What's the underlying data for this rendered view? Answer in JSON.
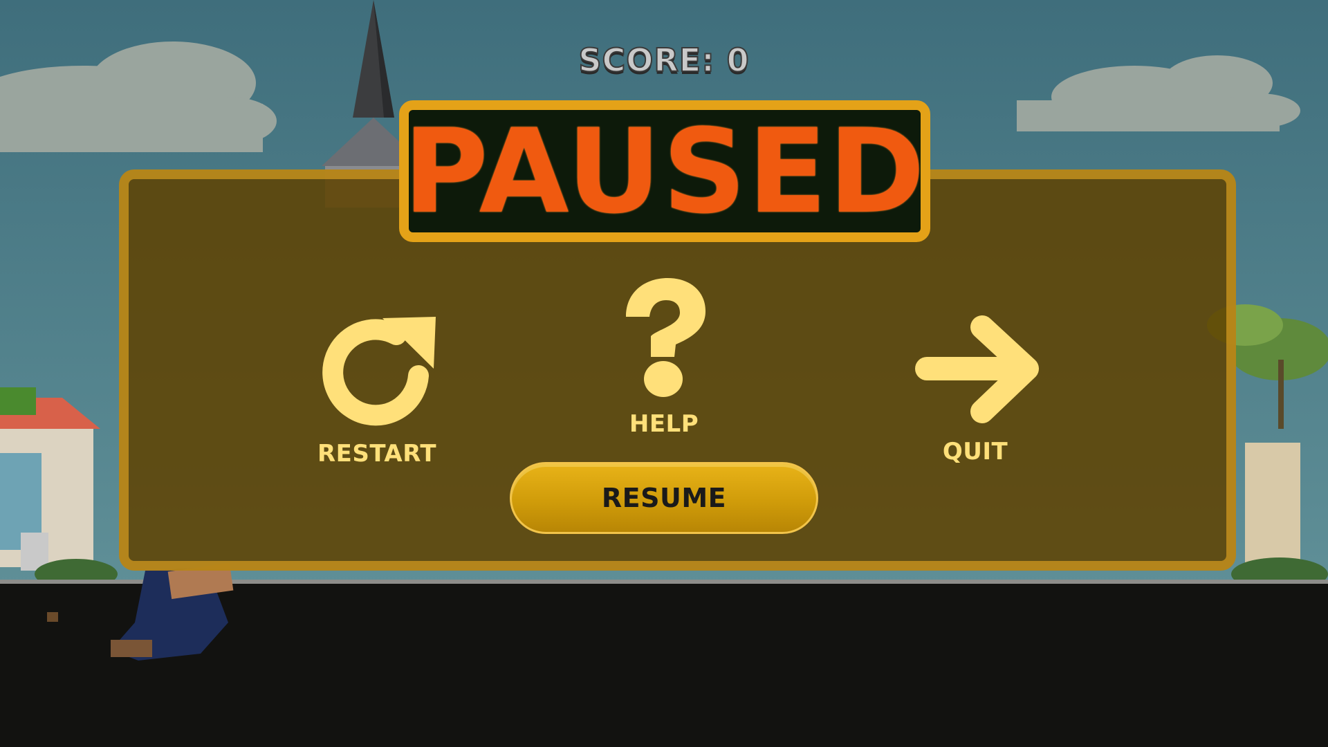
{
  "hud": {
    "score_text": "SCORE: 0"
  },
  "pause_menu": {
    "title": "PAUSED",
    "actions": [
      {
        "label": "RESTART",
        "icon": "restart-icon"
      },
      {
        "label": "HELP",
        "icon": "question-mark-icon"
      },
      {
        "label": "QUIT",
        "icon": "arrow-right-icon"
      }
    ],
    "resume_label": "RESUME"
  },
  "colors": {
    "title_text": "#f05a10",
    "title_border": "#e4a218",
    "icon_fill": "#ffe07a",
    "panel_border": "#cc961e",
    "resume_button": "#d09c0a"
  }
}
